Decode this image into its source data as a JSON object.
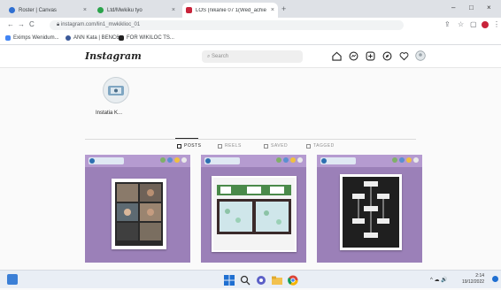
{
  "browser": {
    "tabs": [
      {
        "label": "Roster | Canvas",
        "close": "×"
      },
      {
        "label": "Ltd/Mwkiku tyo",
        "close": "×"
      },
      {
        "label": "LOS (nikanie 07 1(Wed_achieu)",
        "close": "×"
      }
    ],
    "new_tab": "+",
    "window_controls": {
      "minimize": "–",
      "restore": "□",
      "close": "×"
    },
    "nav": {
      "back": "←",
      "forward": "→",
      "reload": "C"
    },
    "url": "instagram.com/lin1_mwkiklioc_01",
    "bookmarks": [
      {
        "label": "Eximps Wenidum..."
      },
      {
        "label": "ANN Kata | BENC6..."
      },
      {
        "label": "FOR WIKILOC TS..."
      }
    ]
  },
  "instagram": {
    "logo": "Instagram",
    "search_placeholder": "Search",
    "profile": {
      "name": "Instatia K..."
    },
    "tabs": [
      {
        "label": "POSTS"
      },
      {
        "label": "REELS"
      },
      {
        "label": "SAVED"
      },
      {
        "label": "TAGGED"
      }
    ]
  },
  "taskbar": {
    "tray_text": "^ ☁ 🔊",
    "clock_time": "2:14",
    "clock_date": "19/12/2022"
  },
  "colors": {
    "post_bg": "#9b80b8",
    "accent_red": "#c8233a",
    "windows_blue": "#1f6fd1"
  }
}
